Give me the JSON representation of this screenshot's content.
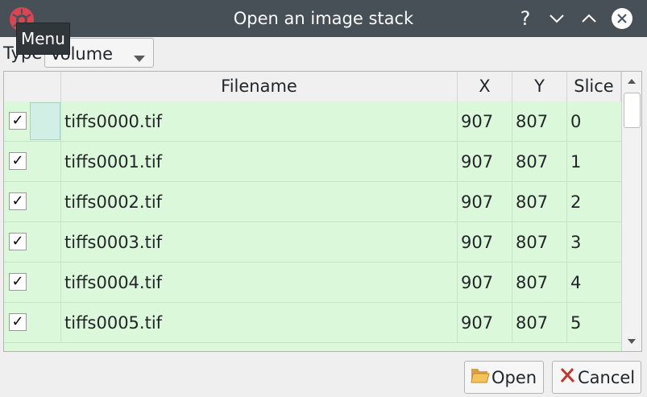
{
  "window": {
    "title": "Open an image stack",
    "tooltip": "Menu",
    "help_glyph": "?"
  },
  "type_selector": {
    "label": "Type",
    "value": "Volume"
  },
  "table": {
    "columns": [
      "",
      "Filename",
      "X",
      "Y",
      "Slice"
    ],
    "rows": [
      {
        "checked": true,
        "filename": "tiffs0000.tif",
        "x": "907",
        "y": "807",
        "slice": "0"
      },
      {
        "checked": true,
        "filename": "tiffs0001.tif",
        "x": "907",
        "y": "807",
        "slice": "1"
      },
      {
        "checked": true,
        "filename": "tiffs0002.tif",
        "x": "907",
        "y": "807",
        "slice": "2"
      },
      {
        "checked": true,
        "filename": "tiffs0003.tif",
        "x": "907",
        "y": "807",
        "slice": "3"
      },
      {
        "checked": true,
        "filename": "tiffs0004.tif",
        "x": "907",
        "y": "807",
        "slice": "4"
      },
      {
        "checked": true,
        "filename": "tiffs0005.tif",
        "x": "907",
        "y": "807",
        "slice": "5"
      }
    ],
    "check_glyph": "✓",
    "row_color": "#dbf8da"
  },
  "buttons": {
    "open_label": "Open",
    "cancel_label": "Cancel"
  },
  "icons": {
    "app": "app-menu-icon",
    "help": "help-icon",
    "minimize": "chevron-down-icon",
    "maximize": "chevron-up-icon",
    "close": "close-icon",
    "open": "folder-icon",
    "cancel": "cancel-x-icon"
  },
  "colors": {
    "titlebar": "#475057",
    "accent_red": "#da4453"
  }
}
